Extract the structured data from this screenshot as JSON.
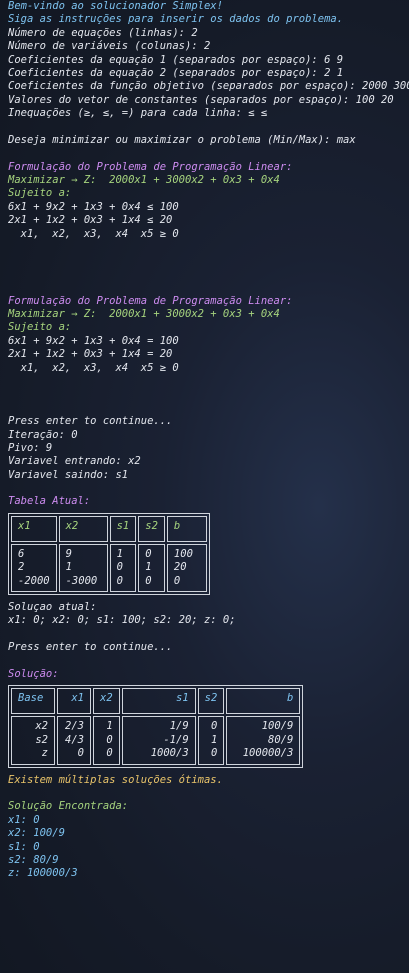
{
  "header_lines": [
    {
      "text": "Bem-vindo ao solucionador Simplex!",
      "cls": "blue"
    },
    {
      "text": "Siga as instruções para inserir os dados do problema.",
      "cls": "blue"
    },
    {
      "text": "Número de equações (linhas): 2",
      "cls": "white"
    },
    {
      "text": "Número de variáveis (colunas): 2",
      "cls": "white"
    },
    {
      "text": "Coeficientes da equação 1 (separados por espaço): 6 9",
      "cls": "white"
    },
    {
      "text": "Coeficientes da equação 2 (separados por espaço): 2 1",
      "cls": "white"
    },
    {
      "text": "Coeficientes da função objetivo (separados por espaço): 2000 3000",
      "cls": "white"
    },
    {
      "text": "Valores do vetor de constantes (separados por espaço): 100 20",
      "cls": "white"
    },
    {
      "text": "Inequações (≥, ≤, =) para cada linha: ≤ ≤",
      "cls": "white"
    },
    {
      "text": "",
      "cls": "white"
    },
    {
      "text": "Deseja minimizar ou maximizar o problema (Min/Max): max",
      "cls": "white"
    }
  ],
  "formulation1": {
    "title": "Formulação do Problema de Programação Linear:",
    "objective": "Maximizar → Z:  2000x1 + 3000x2 + 0x3 + 0x4",
    "subject": "Sujeito a:",
    "c1": "6x1 + 9x2 + 1x3 + 0x4 ≤ 100",
    "c2": "2x1 + 1x2 + 0x3 + 1x4 ≤ 20",
    "nonneg": "  x1,  x2,  x3,  x4  x5 ≥ 0"
  },
  "formulation2": {
    "title": "Formulação do Problema de Programação Linear:",
    "objective": "Maximizar → Z:  2000x1 + 3000x2 + 0x3 + 0x4",
    "subject": "Sujeito a:",
    "c1": "6x1 + 9x2 + 1x3 + 0x4 = 100",
    "c2": "2x1 + 1x2 + 0x3 + 1x4 = 20",
    "nonneg": "  x1,  x2,  x3,  x4  x5 ≥ 0"
  },
  "iteration": {
    "press": "Press enter to continue...",
    "iter": "Iteração: 0",
    "pivot": "Pivo: 9",
    "entering": "Variavel entrando: x2",
    "leaving": "Variavel saindo: s1"
  },
  "table_title": "Tabela Atual:",
  "table_headers": [
    "x1",
    "x2",
    "s1",
    "s2",
    "b"
  ],
  "table_cols": [
    "6\n2\n-2000",
    "9\n1\n-3000",
    "1\n0\n0",
    "0\n1\n0",
    "100\n20\n0"
  ],
  "current_solution": {
    "title": "Soluçao atual:",
    "values": "x1: 0; x2: 0; s1: 100; s2: 20; z: 0;"
  },
  "press2": "Press enter to continue...",
  "solution_title": "Solução:",
  "sol_headers": [
    "Base",
    "x1",
    "x2",
    "s1",
    "s2",
    "b"
  ],
  "sol_cols": [
    "x2\ns2\nz",
    "2/3\n4/3\n0",
    "1\n0\n0",
    "1/9\n-1/9\n1000/3",
    "0\n1\n0",
    "100/9\n80/9\n100000/3"
  ],
  "multiple": "Existem múltiplas soluções ótimas.",
  "found_title": "Solução Encontrada:",
  "found": [
    "x1: 0",
    "x2: 100/9",
    "s1: 0",
    "s2: 80/9",
    "z: 100000/3"
  ]
}
